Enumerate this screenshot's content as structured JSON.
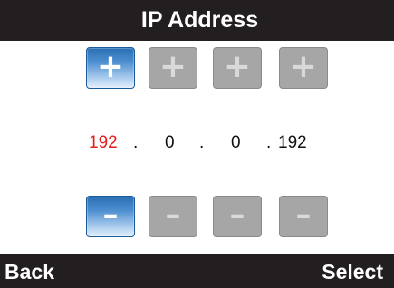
{
  "title": "IP Address",
  "plus_buttons": [
    {
      "glyph": "+",
      "state": "active"
    },
    {
      "glyph": "+",
      "state": "inactive"
    },
    {
      "glyph": "+",
      "state": "inactive"
    },
    {
      "glyph": "+",
      "state": "inactive"
    }
  ],
  "minus_buttons": [
    {
      "glyph": "–",
      "state": "active"
    },
    {
      "glyph": "–",
      "state": "inactive"
    },
    {
      "glyph": "–",
      "state": "inactive"
    },
    {
      "glyph": "–",
      "state": "inactive"
    }
  ],
  "ip": {
    "octets": [
      "192",
      "0",
      "0",
      "192"
    ],
    "separator": ".",
    "selected_octet_index": 0
  },
  "softkeys": {
    "left": "Back",
    "right": "Select"
  },
  "colors": {
    "bar_background": "#231f20",
    "selected_octet": "#e0201b",
    "active_button": "#4d8fd0",
    "inactive_button": "#a6a6a6"
  }
}
